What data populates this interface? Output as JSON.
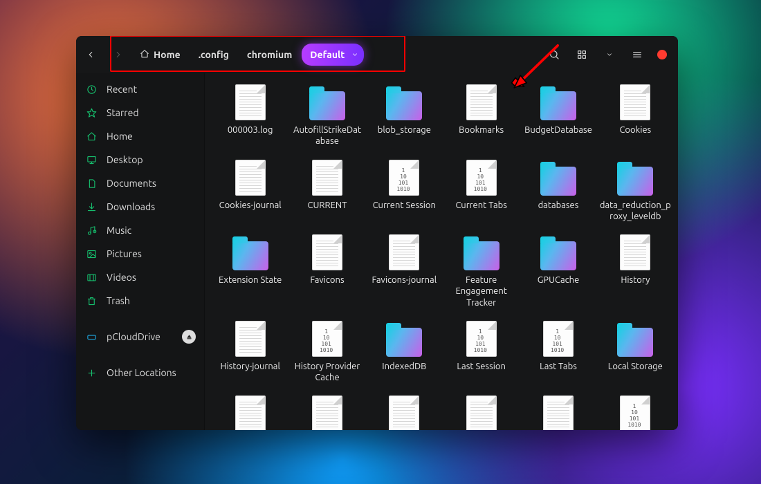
{
  "breadcrumbs": {
    "home": "Home",
    "config": ".config",
    "chromium": "chromium",
    "default": "Default"
  },
  "sidebar": {
    "recent": "Recent",
    "starred": "Starred",
    "home": "Home",
    "desktop": "Desktop",
    "documents": "Documents",
    "downloads": "Downloads",
    "music": "Music",
    "pictures": "Pictures",
    "videos": "Videos",
    "trash": "Trash",
    "pcloud": "pCloudDrive",
    "other": "Other Locations"
  },
  "files": [
    {
      "name": "000003.log",
      "kind": "doc"
    },
    {
      "name": "AutofillStrikeDatabase",
      "kind": "folder"
    },
    {
      "name": "blob_storage",
      "kind": "folder"
    },
    {
      "name": "Bookmarks",
      "kind": "doc"
    },
    {
      "name": "BudgetDatabase",
      "kind": "folder"
    },
    {
      "name": "Cookies",
      "kind": "doc"
    },
    {
      "name": "Cookies-journal",
      "kind": "doc"
    },
    {
      "name": "CURRENT",
      "kind": "doc"
    },
    {
      "name": "Current Session",
      "kind": "bin"
    },
    {
      "name": "Current Tabs",
      "kind": "bin"
    },
    {
      "name": "databases",
      "kind": "folder"
    },
    {
      "name": "data_reduction_proxy_leveldb",
      "kind": "folder"
    },
    {
      "name": "Extension State",
      "kind": "folder"
    },
    {
      "name": "Favicons",
      "kind": "doc"
    },
    {
      "name": "Favicons-journal",
      "kind": "doc"
    },
    {
      "name": "Feature Engagement Tracker",
      "kind": "folder"
    },
    {
      "name": "GPUCache",
      "kind": "folder"
    },
    {
      "name": "History",
      "kind": "doc"
    },
    {
      "name": "History-journal",
      "kind": "doc"
    },
    {
      "name": "History Provider Cache",
      "kind": "bin"
    },
    {
      "name": "IndexedDB",
      "kind": "folder"
    },
    {
      "name": "Last Session",
      "kind": "bin"
    },
    {
      "name": "Last Tabs",
      "kind": "bin"
    },
    {
      "name": "Local Storage",
      "kind": "folder"
    },
    {
      "name": "",
      "kind": "doc"
    },
    {
      "name": "",
      "kind": "doc"
    },
    {
      "name": "",
      "kind": "doc"
    },
    {
      "name": "",
      "kind": "doc"
    },
    {
      "name": "",
      "kind": "doc"
    },
    {
      "name": "",
      "kind": "bin"
    }
  ],
  "bin_preview": "1\n10\n101\n1010"
}
